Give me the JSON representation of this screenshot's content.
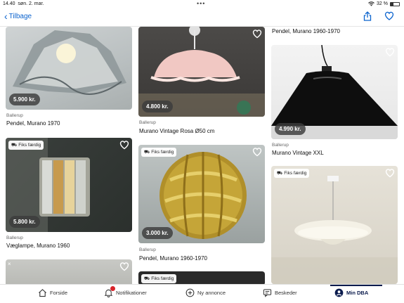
{
  "status_bar": {
    "time": "14.40",
    "date": "søn. 2. mar.",
    "dots": "•••",
    "battery_text": "32 %",
    "battery_level": 0.32
  },
  "nav": {
    "back_label": "Tilbage",
    "accent": "#0b63ce"
  },
  "listings": [
    {
      "price": "5.900 kr.",
      "location": "Ballerup",
      "title": "Pendel, Murano 1970",
      "fixed": false
    },
    {
      "price": "4.800 kr.",
      "location": "Ballerup",
      "title": "Murano Vintage Rosa Ø50 cm",
      "fixed": false
    },
    {
      "price": "",
      "location": "",
      "title": "Pendel, Murano 1960-1970",
      "fixed": false
    },
    {
      "price": "4.990 kr.",
      "location": "Ballerup",
      "title": "Murano Vintage XXL",
      "fixed": false
    },
    {
      "price": "5.800 kr.",
      "location": "Ballerup",
      "title": "Væglampe, Murano 1960",
      "fixed": true,
      "badge": "Fiks færdig"
    },
    {
      "price": "3.000 kr.",
      "location": "Ballerup",
      "title": "Pendel, Murano 1960-1970",
      "fixed": true,
      "badge": "Fiks færdig"
    },
    {
      "price": "",
      "location": "",
      "title": "",
      "fixed": true,
      "badge": "Fiks færdig"
    },
    {
      "price": "",
      "location": "",
      "title": "",
      "fixed": false
    },
    {
      "price": "",
      "location": "",
      "title": "",
      "fixed": true,
      "badge": "Fiks færdig"
    }
  ],
  "tabbar": {
    "items": [
      {
        "label": "Forside",
        "icon": "home-icon"
      },
      {
        "label": "Notifikationer",
        "icon": "bell-icon"
      },
      {
        "label": "Ny annonce",
        "icon": "plus-circle-icon"
      },
      {
        "label": "Beskeder",
        "icon": "chat-icon"
      },
      {
        "label": "Min DBA",
        "icon": "user-icon"
      }
    ],
    "active": "Min DBA",
    "notification_color": "#d8232a"
  }
}
